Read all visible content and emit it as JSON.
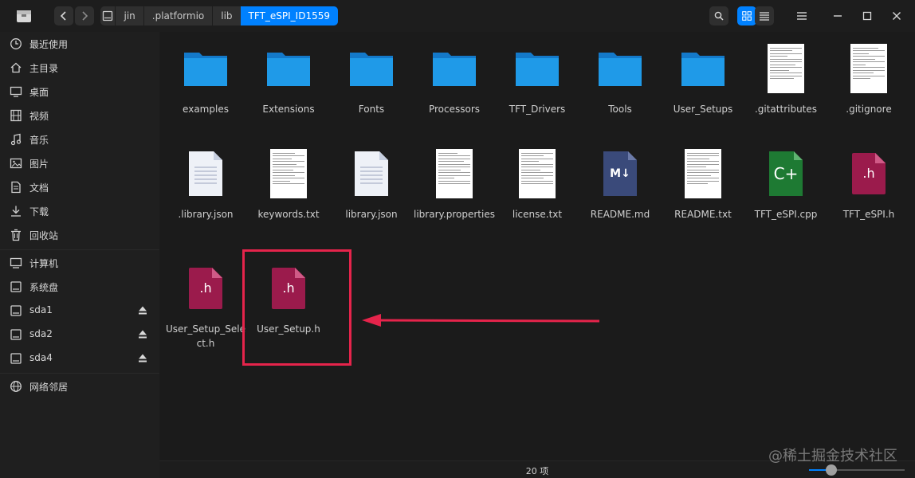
{
  "toolbar": {
    "back_icon": "chevron-left-icon",
    "forward_icon": "chevron-right-icon",
    "breadcrumbs": [
      "jin",
      ".platformio",
      "lib",
      "TFT_eSPI_ID1559"
    ],
    "search_icon": "search-icon",
    "view_icons": [
      "grid-view-icon",
      "list-view-icon"
    ]
  },
  "sidebar": {
    "items": [
      {
        "label": "最近使用",
        "icon": "clock-icon"
      },
      {
        "label": "主目录",
        "icon": "home-icon"
      },
      {
        "label": "桌面",
        "icon": "desktop-icon"
      },
      {
        "label": "视频",
        "icon": "video-icon"
      },
      {
        "label": "音乐",
        "icon": "music-icon"
      },
      {
        "label": "图片",
        "icon": "picture-icon"
      },
      {
        "label": "文档",
        "icon": "document-icon"
      },
      {
        "label": "下载",
        "icon": "download-icon"
      },
      {
        "label": "回收站",
        "icon": "trash-icon"
      },
      {
        "label": "计算机",
        "icon": "computer-icon"
      },
      {
        "label": "系统盘",
        "icon": "disk-icon"
      },
      {
        "label": "sda1",
        "icon": "disk-icon"
      },
      {
        "label": "sda2",
        "icon": "disk-icon"
      },
      {
        "label": "sda4",
        "icon": "disk-icon"
      },
      {
        "label": "网络邻居",
        "icon": "network-icon"
      }
    ]
  },
  "files": [
    {
      "name": "examples",
      "type": "folder"
    },
    {
      "name": "Extensions",
      "type": "folder"
    },
    {
      "name": "Fonts",
      "type": "folder"
    },
    {
      "name": "Processors",
      "type": "folder"
    },
    {
      "name": "TFT_Drivers",
      "type": "folder"
    },
    {
      "name": "Tools",
      "type": "folder"
    },
    {
      "name": "User_Setups",
      "type": "folder"
    },
    {
      "name": ".gitattributes",
      "type": "text-thumb"
    },
    {
      "name": ".gitignore",
      "type": "text-thumb"
    },
    {
      "name": ".library.json",
      "type": "json"
    },
    {
      "name": "keywords.txt",
      "type": "text-thumb"
    },
    {
      "name": "library.json",
      "type": "json"
    },
    {
      "name": "library.properties",
      "type": "text-thumb"
    },
    {
      "name": "license.txt",
      "type": "text-thumb"
    },
    {
      "name": "README.md",
      "type": "markdown"
    },
    {
      "name": "README.txt",
      "type": "text-thumb"
    },
    {
      "name": "TFT_eSPI.cpp",
      "type": "cpp"
    },
    {
      "name": "TFT_eSPI.h",
      "type": "header"
    },
    {
      "name": "User_Setup_Select.h",
      "type": "header"
    },
    {
      "name": "User_Setup.h",
      "type": "header"
    }
  ],
  "icon_text": {
    "header": ".h",
    "markdown": "M↓",
    "cpp": "C+"
  },
  "status": {
    "count": "20 项"
  },
  "watermark": "@稀土掘金技术社区",
  "colors": {
    "accent": "#0081ff",
    "folder": "#1f9ae8",
    "header": "#9b1b4c",
    "cpp": "#1e7a33",
    "markdown": "#3a4a7a",
    "highlight": "#e5244b"
  }
}
